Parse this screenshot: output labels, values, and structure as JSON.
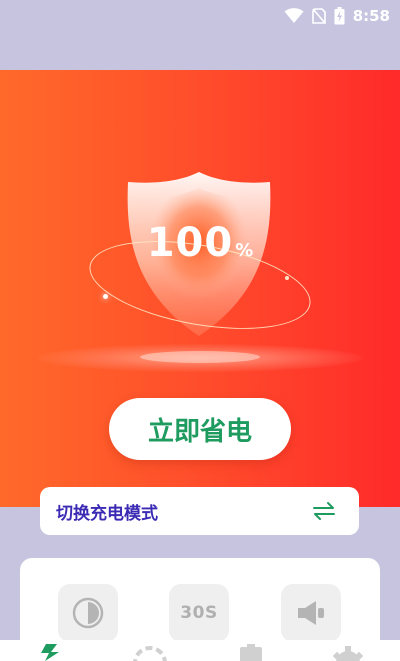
{
  "status_bar": {
    "time": "8:58",
    "icons": [
      "wifi-icon",
      "no-sim-icon",
      "battery-charging-icon"
    ]
  },
  "hero": {
    "percent_value": "100",
    "percent_unit": "%",
    "gradient_start": "#ff6a2a",
    "gradient_end": "#ff2a2a"
  },
  "actions": {
    "save_power_label": "立即省电",
    "save_power_color": "#1e9b5e"
  },
  "charge_mode": {
    "label": "切换充电模式",
    "label_color": "#3b2bb4",
    "icon": "swap-arrows-icon"
  },
  "tiles": [
    {
      "icon": "brightness-icon",
      "text": ""
    },
    {
      "icon": "timeout-icon",
      "text": "30S"
    },
    {
      "icon": "speaker-icon",
      "text": ""
    }
  ],
  "bottom_nav": {
    "items": [
      {
        "icon": "lightning-icon",
        "active": true
      },
      {
        "icon": "circle-dial-icon",
        "active": false
      },
      {
        "icon": "battery-icon",
        "active": false
      },
      {
        "icon": "gear-icon",
        "active": false
      }
    ],
    "active_color": "#1e9b5e"
  }
}
